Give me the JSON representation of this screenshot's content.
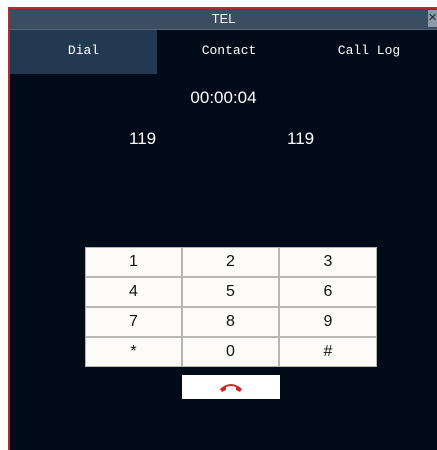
{
  "window": {
    "title": "TEL",
    "close_glyph": "✕"
  },
  "tabs": [
    {
      "label": "Dial",
      "active": true
    },
    {
      "label": "Contact",
      "active": false
    },
    {
      "label": "Call Log",
      "active": false
    }
  ],
  "call": {
    "timer": "00:00:04",
    "number_left": "119",
    "number_right": "119"
  },
  "keypad": {
    "keys": [
      "1",
      "2",
      "3",
      "4",
      "5",
      "6",
      "7",
      "8",
      "9",
      "*",
      "0",
      "#"
    ]
  },
  "hangup": {
    "icon": "hang-up-phone-icon",
    "color": "#d42525"
  },
  "colors": {
    "background": "#020b18",
    "titlebar": "#3a4d61",
    "active_tab": "#213a52",
    "border_accent": "#a92e34"
  }
}
